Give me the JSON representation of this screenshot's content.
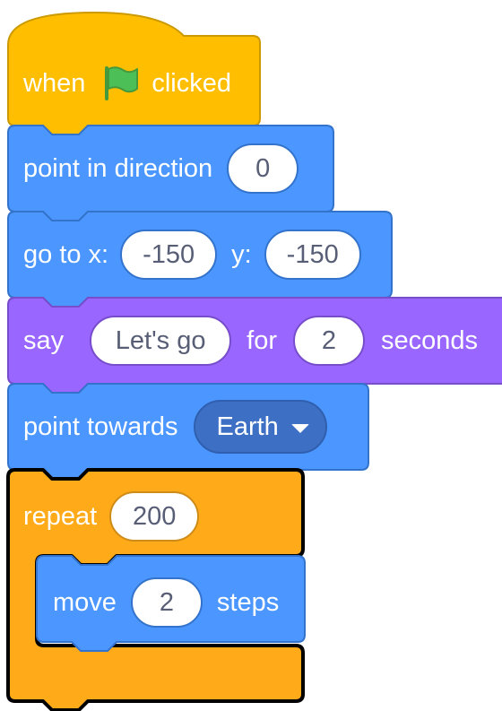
{
  "blocks": {
    "hat": {
      "text_when": "when",
      "icon": "green-flag-icon",
      "text_clicked": "clicked",
      "color": "#ffbf00"
    },
    "point_direction": {
      "text": "point in direction",
      "value": "0",
      "color": "#4c97ff"
    },
    "go_to": {
      "text_go": "go to x:",
      "x": "-150",
      "text_y": "y:",
      "y": "-150",
      "color": "#4c97ff"
    },
    "say": {
      "text_say": "say",
      "message": "Let's go",
      "text_for": "for",
      "secs": "2",
      "text_seconds": "seconds",
      "color": "#9966ff"
    },
    "point_towards": {
      "text": "point towards",
      "target": "Earth",
      "color": "#4c97ff"
    },
    "repeat": {
      "text": "repeat",
      "count": "200",
      "color": "#ffab19"
    },
    "move": {
      "text_move": "move",
      "steps": "2",
      "text_steps": "steps",
      "color": "#4c97ff"
    }
  }
}
